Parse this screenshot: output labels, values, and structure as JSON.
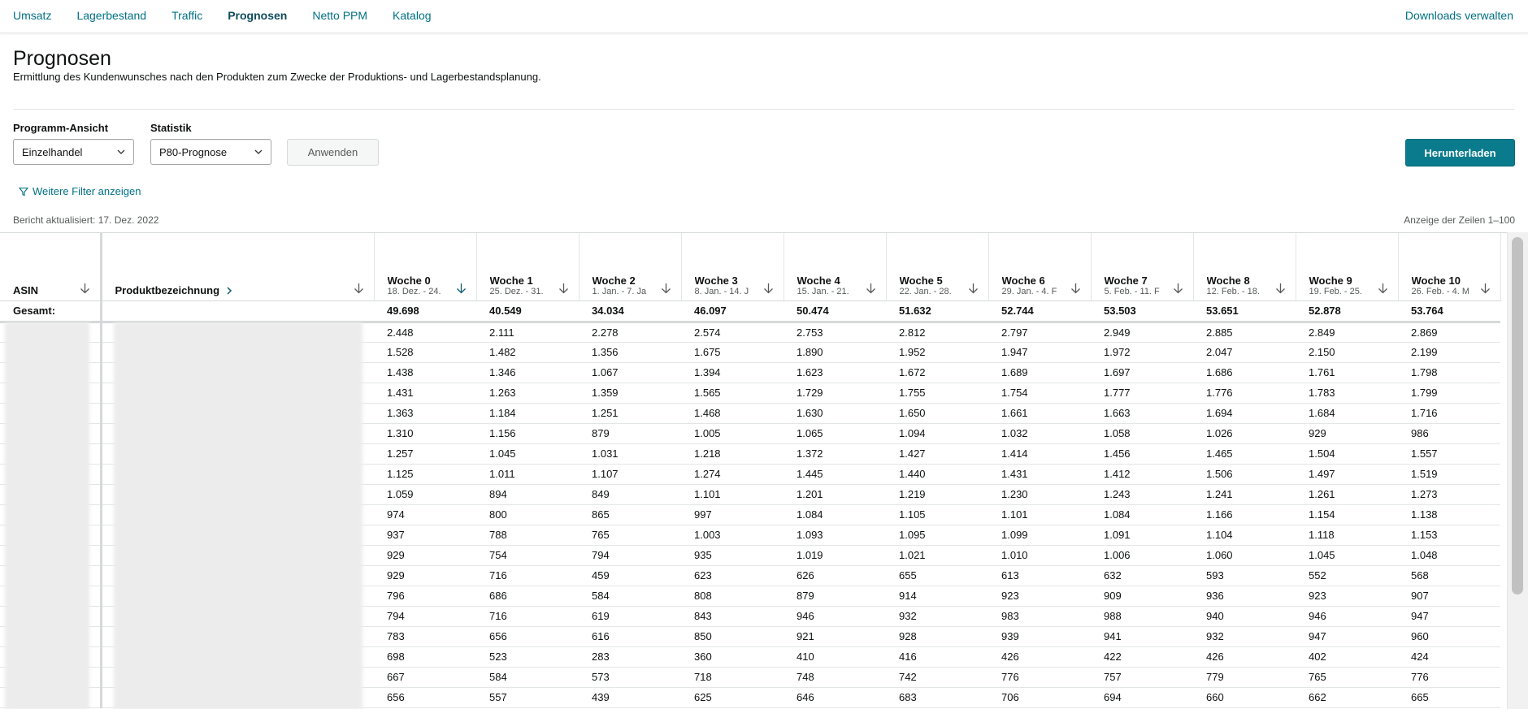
{
  "nav": {
    "tabs": [
      {
        "label": "Umsatz"
      },
      {
        "label": "Lagerbestand"
      },
      {
        "label": "Traffic"
      },
      {
        "label": "Prognosen"
      },
      {
        "label": "Netto PPM"
      },
      {
        "label": "Katalog"
      }
    ],
    "active_tab": "Prognosen",
    "downloads_label": "Downloads verwalten"
  },
  "page": {
    "title": "Prognosen",
    "description": "Ermittlung des Kundenwunsches nach den Produkten zum Zwecke der Produktions- und Lagerbestandsplanung."
  },
  "filters": {
    "program_label": "Programm-Ansicht",
    "program_value": "Einzelhandel",
    "stat_label": "Statistik",
    "stat_value": "P80-Prognose",
    "apply_label": "Anwenden",
    "download_label": "Herunterladen",
    "more_filters_label": "Weitere Filter anzeigen"
  },
  "report": {
    "updated": "Bericht aktualisiert: 17. Dez. 2022",
    "rows_shown": "Anzeige der Zeilen 1–100"
  },
  "colors": {
    "link": "#007185",
    "primary_button": "#0a7b8c",
    "active_sort": "#0f5c72"
  },
  "table": {
    "asin_header": "ASIN",
    "name_header": "Produktbezeichnung",
    "total_label": "Gesamt:",
    "weeks": [
      {
        "label": "Woche 0",
        "range": "18. Dez. - 24."
      },
      {
        "label": "Woche 1",
        "range": "25. Dez. - 31."
      },
      {
        "label": "Woche 2",
        "range": "1. Jan. - 7. Ja"
      },
      {
        "label": "Woche 3",
        "range": "8. Jan. - 14. J"
      },
      {
        "label": "Woche 4",
        "range": "15. Jan. - 21."
      },
      {
        "label": "Woche 5",
        "range": "22. Jan. - 28."
      },
      {
        "label": "Woche 6",
        "range": "29. Jan. - 4. F"
      },
      {
        "label": "Woche 7",
        "range": "5. Feb. - 11. F"
      },
      {
        "label": "Woche 8",
        "range": "12. Feb. - 18."
      },
      {
        "label": "Woche 9",
        "range": "19. Feb. - 25."
      },
      {
        "label": "Woche 10",
        "range": "26. Feb. - 4. M"
      }
    ],
    "totals": [
      "49.698",
      "40.549",
      "34.034",
      "46.097",
      "50.474",
      "51.632",
      "52.744",
      "53.503",
      "53.651",
      "52.878",
      "53.764"
    ],
    "rows": [
      [
        "2.448",
        "2.111",
        "2.278",
        "2.574",
        "2.753",
        "2.812",
        "2.797",
        "2.949",
        "2.885",
        "2.849",
        "2.869"
      ],
      [
        "1.528",
        "1.482",
        "1.356",
        "1.675",
        "1.890",
        "1.952",
        "1.947",
        "1.972",
        "2.047",
        "2.150",
        "2.199"
      ],
      [
        "1.438",
        "1.346",
        "1.067",
        "1.394",
        "1.623",
        "1.672",
        "1.689",
        "1.697",
        "1.686",
        "1.761",
        "1.798"
      ],
      [
        "1.431",
        "1.263",
        "1.359",
        "1.565",
        "1.729",
        "1.755",
        "1.754",
        "1.777",
        "1.776",
        "1.783",
        "1.799"
      ],
      [
        "1.363",
        "1.184",
        "1.251",
        "1.468",
        "1.630",
        "1.650",
        "1.661",
        "1.663",
        "1.694",
        "1.684",
        "1.716"
      ],
      [
        "1.310",
        "1.156",
        "879",
        "1.005",
        "1.065",
        "1.094",
        "1.032",
        "1.058",
        "1.026",
        "929",
        "986"
      ],
      [
        "1.257",
        "1.045",
        "1.031",
        "1.218",
        "1.372",
        "1.427",
        "1.414",
        "1.456",
        "1.465",
        "1.504",
        "1.557"
      ],
      [
        "1.125",
        "1.011",
        "1.107",
        "1.274",
        "1.445",
        "1.440",
        "1.431",
        "1.412",
        "1.506",
        "1.497",
        "1.519"
      ],
      [
        "1.059",
        "894",
        "849",
        "1.101",
        "1.201",
        "1.219",
        "1.230",
        "1.243",
        "1.241",
        "1.261",
        "1.273"
      ],
      [
        "974",
        "800",
        "865",
        "997",
        "1.084",
        "1.105",
        "1.101",
        "1.084",
        "1.166",
        "1.154",
        "1.138"
      ],
      [
        "937",
        "788",
        "765",
        "1.003",
        "1.093",
        "1.095",
        "1.099",
        "1.091",
        "1.104",
        "1.118",
        "1.153"
      ],
      [
        "929",
        "754",
        "794",
        "935",
        "1.019",
        "1.021",
        "1.010",
        "1.006",
        "1.060",
        "1.045",
        "1.048"
      ],
      [
        "929",
        "716",
        "459",
        "623",
        "626",
        "655",
        "613",
        "632",
        "593",
        "552",
        "568"
      ],
      [
        "796",
        "686",
        "584",
        "808",
        "879",
        "914",
        "923",
        "909",
        "936",
        "923",
        "907"
      ],
      [
        "794",
        "716",
        "619",
        "843",
        "946",
        "932",
        "983",
        "988",
        "940",
        "946",
        "947"
      ],
      [
        "783",
        "656",
        "616",
        "850",
        "921",
        "928",
        "939",
        "941",
        "932",
        "947",
        "960"
      ],
      [
        "698",
        "523",
        "283",
        "360",
        "410",
        "416",
        "426",
        "422",
        "426",
        "402",
        "424"
      ],
      [
        "667",
        "584",
        "573",
        "718",
        "748",
        "742",
        "776",
        "757",
        "779",
        "765",
        "776"
      ],
      [
        "656",
        "557",
        "439",
        "625",
        "646",
        "683",
        "706",
        "694",
        "660",
        "662",
        "665"
      ]
    ]
  }
}
